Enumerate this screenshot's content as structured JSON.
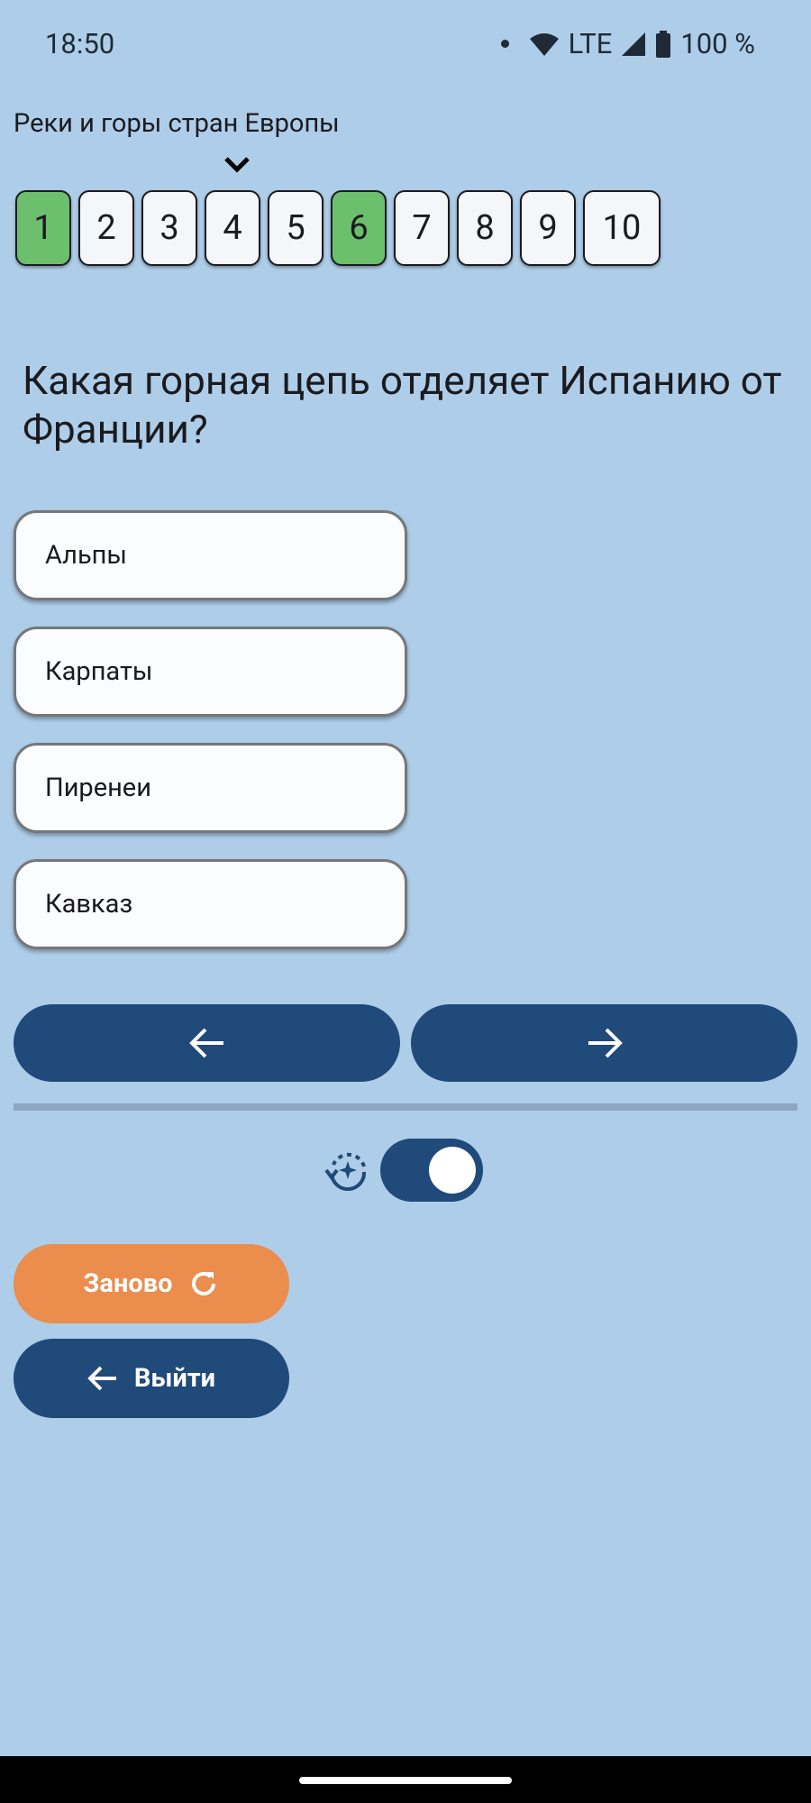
{
  "status_bar": {
    "time": "18:50",
    "network": "LTE",
    "battery": "100 %",
    "icons": [
      "dot-icon",
      "wifi-icon",
      "signal-icon",
      "battery-icon"
    ]
  },
  "quiz": {
    "title": "Реки и горы стран Европы",
    "current_question": 4,
    "questions": [
      {
        "label": "1",
        "answered": true
      },
      {
        "label": "2",
        "answered": false
      },
      {
        "label": "3",
        "answered": false
      },
      {
        "label": "4",
        "answered": false
      },
      {
        "label": "5",
        "answered": false
      },
      {
        "label": "6",
        "answered": true
      },
      {
        "label": "7",
        "answered": false
      },
      {
        "label": "8",
        "answered": false
      },
      {
        "label": "9",
        "answered": false
      },
      {
        "label": "10",
        "answered": false
      }
    ],
    "question_text": "Какая горная цепь отделяет Испанию от Франции?",
    "answers": [
      "Альпы",
      "Карпаты",
      "Пиренеи",
      "Кавказ"
    ]
  },
  "navigation": {
    "prev_icon": "arrow-left-icon",
    "next_icon": "arrow-right-icon"
  },
  "settings": {
    "toggle_icon": "auto-advance-icon",
    "toggle_on": true
  },
  "actions": {
    "restart_label": "Заново",
    "restart_icon": "refresh-icon",
    "exit_label": "Выйти",
    "exit_icon": "arrow-left-icon"
  },
  "colors": {
    "background": "#aecde8",
    "primary": "#1f4a7a",
    "answered": "#6bbf6d",
    "accent": "#ea8d4d"
  }
}
